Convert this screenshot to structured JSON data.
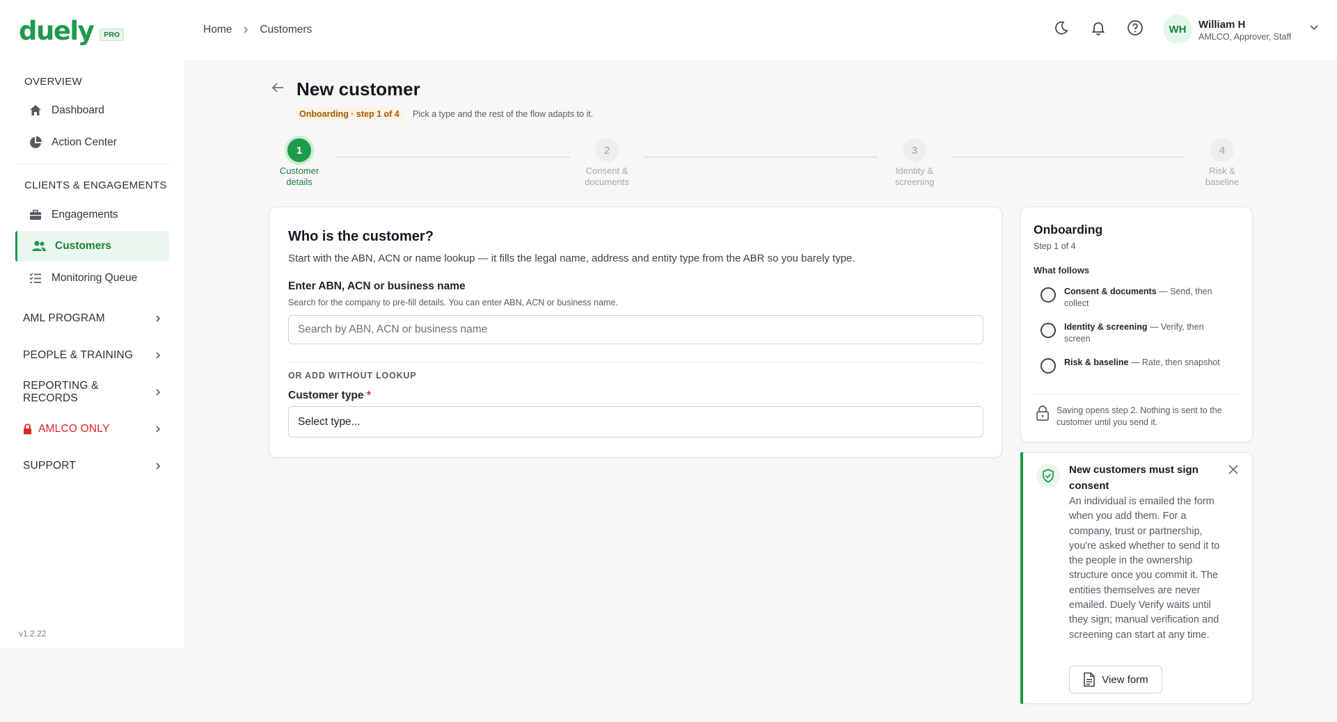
{
  "brand": {
    "name": "duely",
    "badge": "PRO",
    "color": "#1e9a4b"
  },
  "sidebar": {
    "sections": [
      {
        "title": "OVERVIEW",
        "items": [
          {
            "label": "Dashboard",
            "icon": "home-icon"
          },
          {
            "label": "Action Center",
            "icon": "pie-chart-icon"
          }
        ]
      },
      {
        "title": "CLIENTS & ENGAGEMENTS",
        "items": [
          {
            "label": "Engagements",
            "icon": "briefcase-icon"
          },
          {
            "label": "Customers",
            "icon": "users-icon",
            "active": true
          },
          {
            "label": "Monitoring Queue",
            "icon": "checklist-icon"
          }
        ]
      }
    ],
    "groups": [
      {
        "label": "AML PROGRAM"
      },
      {
        "label": "PEOPLE & TRAINING"
      },
      {
        "label": "REPORTING & RECORDS"
      },
      {
        "label": "AMLCO ONLY",
        "icon": "lock-icon",
        "color": "#e02424"
      },
      {
        "label": "SUPPORT"
      }
    ],
    "version": "v1.2.22"
  },
  "header": {
    "breadcrumb": [
      "Home",
      "Customers"
    ],
    "icons": [
      "moon-icon",
      "bell-icon",
      "help-icon"
    ],
    "user": {
      "initials": "WH",
      "name": "William H",
      "role": "AMLCO, Approver, Staff"
    }
  },
  "page": {
    "title": "New customer",
    "step_badge": "Onboarding · step 1 of 4",
    "step_hint": "Pick a type and the rest of the flow adapts to it."
  },
  "stepper": [
    {
      "number": "1",
      "line1": "Customer",
      "line2": "details",
      "state": "active"
    },
    {
      "number": "2",
      "line1": "Consent &",
      "line2": "documents",
      "state": "pending"
    },
    {
      "number": "3",
      "line1": "Identity &",
      "line2": "screening",
      "state": "pending"
    },
    {
      "number": "4",
      "line1": "Risk &",
      "line2": "baseline",
      "state": "pending"
    }
  ],
  "form": {
    "title": "Who is the customer?",
    "subtitle": "Start with the ABN, ACN or name lookup — it fills the legal name, address and entity type from the ABR so you barely type.",
    "lookup_label": "Enter ABN, ACN or business name",
    "lookup_help": "Search for the company to pre-fill details. You can enter ABN, ACN or business name.",
    "lookup_placeholder": "Search by ABN, ACN or business name",
    "or_label": "OR ADD WITHOUT LOOKUP",
    "type_label": "Customer type",
    "type_required": "*",
    "type_value": "Select type..."
  },
  "onboarding": {
    "title": "Onboarding",
    "subtitle": "Step 1 of 4",
    "section": "What follows",
    "items": [
      {
        "name": "Consent & documents",
        "desc": " — Send, then collect"
      },
      {
        "name": "Identity & screening",
        "desc": " — Verify, then screen"
      },
      {
        "name": "Risk & baseline",
        "desc": " — Rate, then snapshot"
      }
    ],
    "note": "Saving opens step 2. Nothing is sent to the customer until you send it."
  },
  "callout": {
    "title": "New customers must sign consent",
    "body": "An individual is emailed the form when you add them. For a company, trust or partnership, you're asked whether to send it to the people in the ownership structure once you commit it. The entities themselves are never emailed. Duely Verify waits until they sign; manual verification and screening can start at any time.",
    "button": "View form"
  }
}
